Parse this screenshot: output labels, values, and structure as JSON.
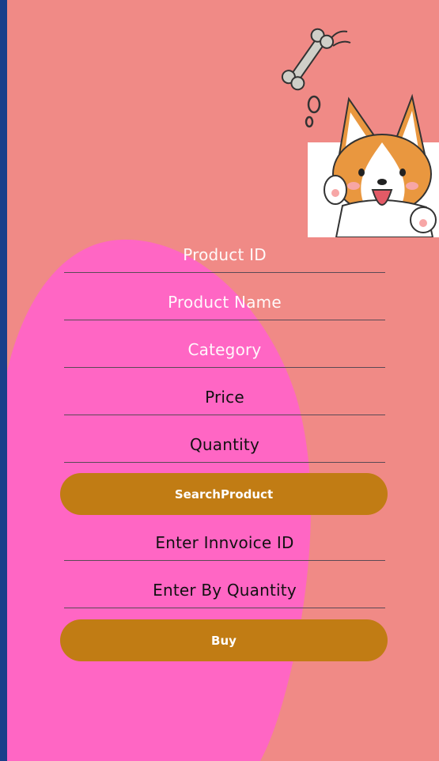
{
  "form": {
    "product_id": {
      "placeholder": "Product ID",
      "value": ""
    },
    "product_name": {
      "placeholder": "Product Name",
      "value": ""
    },
    "category": {
      "placeholder": "Category",
      "value": ""
    },
    "price": {
      "placeholder": "",
      "value": "Price"
    },
    "quantity": {
      "placeholder": "",
      "value": "Quantity"
    },
    "search_button": "SearchProduct",
    "invoice_id": {
      "placeholder": "",
      "value": "Enter Innvoice ID"
    },
    "buy_quantity": {
      "placeholder": "",
      "value": "Enter By Quantity"
    },
    "buy_button": "Buy"
  },
  "colors": {
    "background": "#f08a86",
    "blob": "#ff66c4",
    "button": "#c17c14",
    "frame": "#1a3f8a"
  },
  "illustration": {
    "icon": "corgi-with-bone-icon"
  }
}
